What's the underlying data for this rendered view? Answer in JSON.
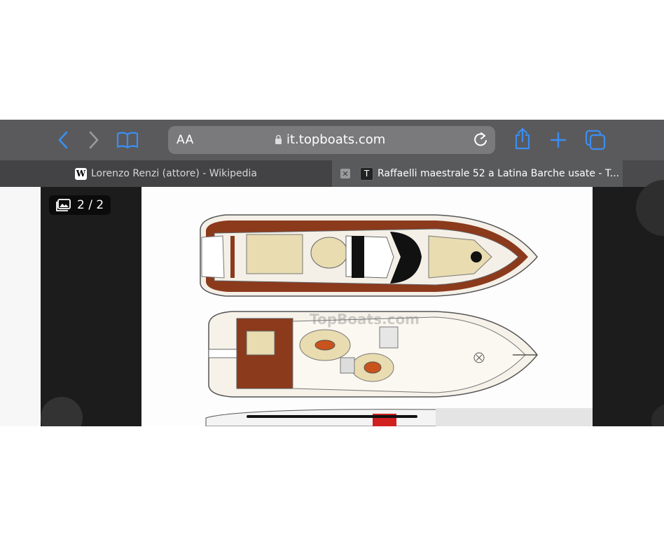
{
  "toolbar": {
    "text_size_label": "AA",
    "url": "it.topboats.com"
  },
  "tabs": [
    {
      "favicon": "W",
      "title": "Lorenzo Renzi (attore) - Wikipedia"
    },
    {
      "favicon": "T",
      "title": "Raffaelli maestrale 52 a Latina Barche usate - T...",
      "close": "✕"
    }
  ],
  "gallery": {
    "counter": "2 / 2"
  },
  "image": {
    "watermark": "TopBoats.com"
  },
  "colors": {
    "toolbar": "#5a5a5c",
    "accent": "#3b8ef3",
    "deck_wood": "#8b3a1c",
    "teak": "#e8dcb0"
  }
}
